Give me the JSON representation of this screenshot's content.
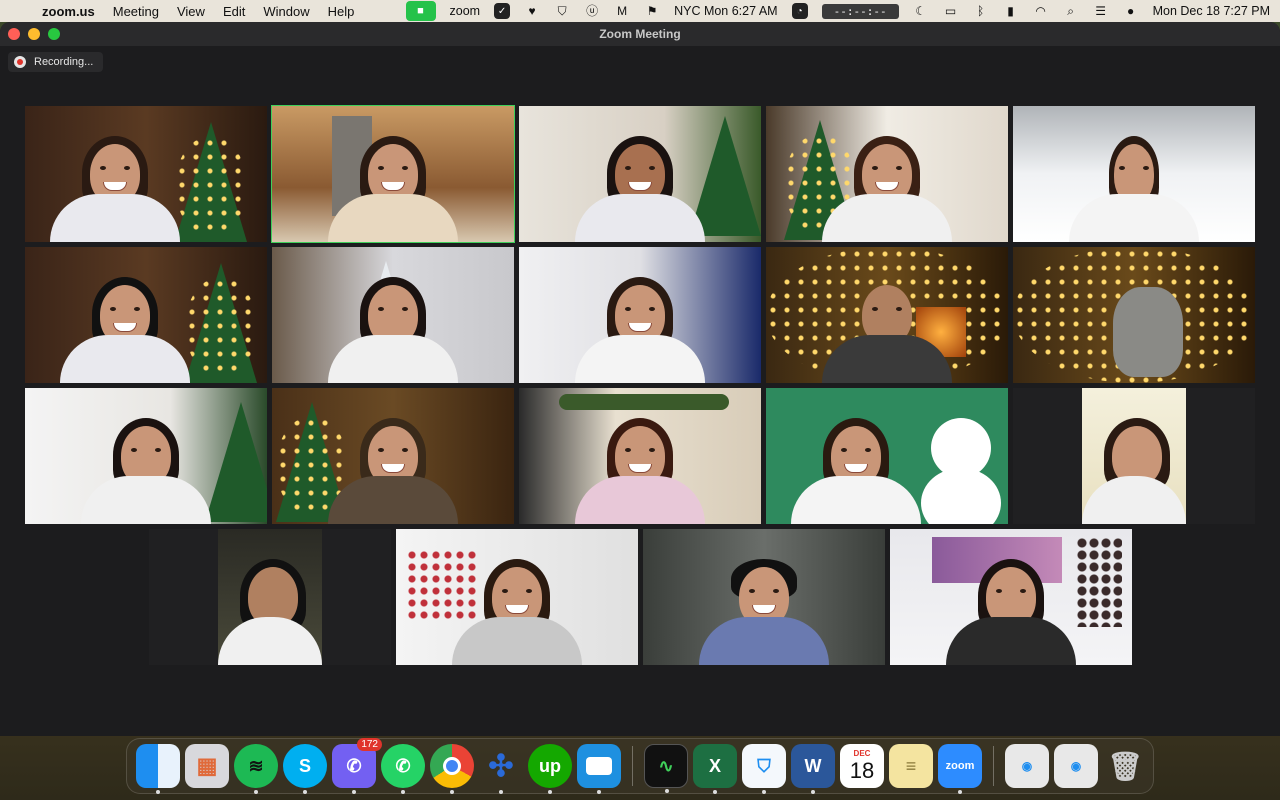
{
  "menubar": {
    "app_name": "zoom.us",
    "menus": [
      "Meeting",
      "View",
      "Edit",
      "Window",
      "Help"
    ],
    "status_zoom_label": "zoom",
    "world_clock": "NYC Mon 6:27 AM",
    "timer": "--:--:--",
    "datetime": "Mon Dec 18  7:27 PM"
  },
  "window": {
    "title": "Zoom Meeting",
    "recording_label": "Recording...",
    "accent_color": "#3fd05a"
  },
  "dock": {
    "viber_badge": "172",
    "upwork_label": "up",
    "excel_label": "X",
    "word_label": "W",
    "calendar_month": "DEC",
    "calendar_day": "18",
    "zoom_label": "zoom"
  }
}
